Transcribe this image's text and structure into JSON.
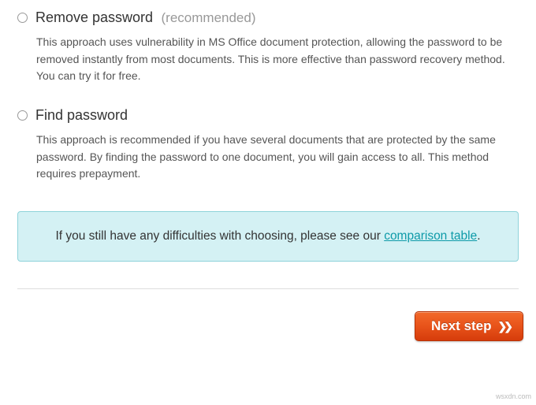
{
  "options": {
    "remove": {
      "title": "Remove password",
      "hint": "(recommended)",
      "desc": "This approach uses vulnerability in MS Office document protection, allowing the password to be removed instantly from most documents. This is more effective than password recovery method. You can try it for free."
    },
    "find": {
      "title": "Find password",
      "desc": "This approach is recommended if you have several documents that are protected by the same password. By finding the password to one document, you will gain access to all. This method requires prepayment."
    }
  },
  "infobox": {
    "prefix": "If you still have any difficulties with choosing, please see our ",
    "link_text": "comparison table",
    "suffix": "."
  },
  "footer": {
    "next_label": "Next step"
  },
  "watermark": "wsxdn.com"
}
